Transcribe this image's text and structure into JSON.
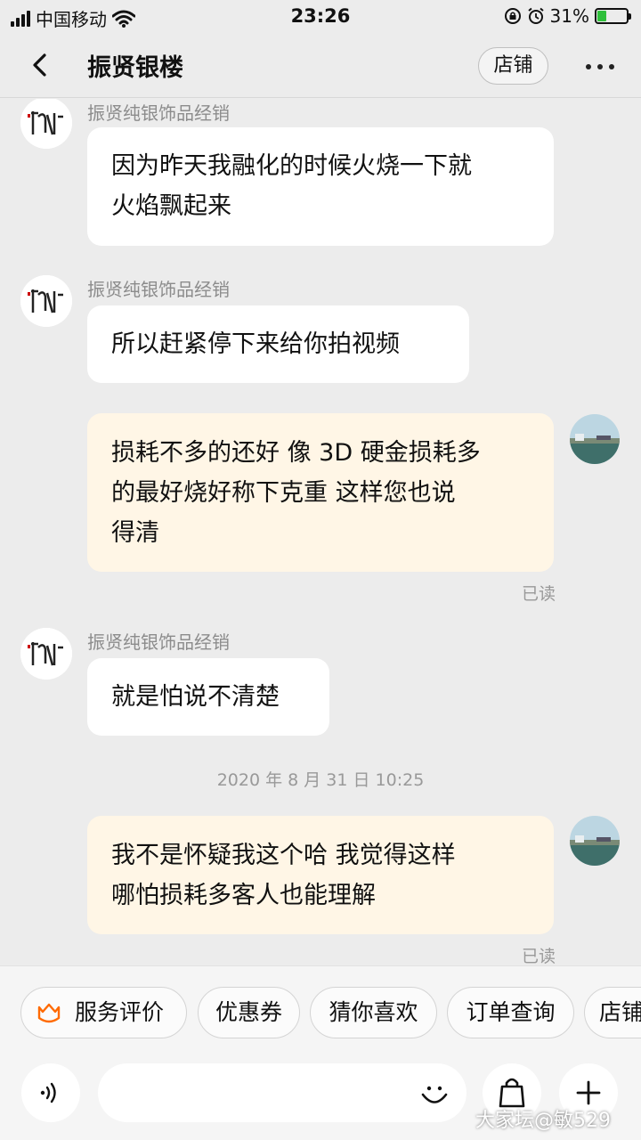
{
  "status_bar": {
    "carrier": "中国移动",
    "time": "23:26",
    "battery_percent": "31%",
    "battery_level": 0.31
  },
  "header": {
    "title": "振贤银楼",
    "shop_button_label": "店铺"
  },
  "messages": [
    {
      "sender": "振贤纯银饰品经销",
      "text_lines": [
        "因为昨天我融化的时候火烧一下就",
        "火焰飘起来"
      ]
    },
    {
      "sender": "振贤纯银饰品经销",
      "text_lines": [
        "所以赶紧停下来给你拍视频"
      ]
    },
    {
      "text_lines": [
        "损耗不多的还好 像 3D 硬金损耗多",
        "的最好烧好称下克重 这样您也说",
        "得清"
      ],
      "status": "已读"
    },
    {
      "sender": "振贤纯银饰品经销",
      "text_lines": [
        "就是怕说不清楚"
      ]
    },
    {
      "timestamp": "2020 年 8 月 31 日 10:25"
    },
    {
      "text_lines": [
        "我不是怀疑我这个哈 我觉得这样",
        "哪怕损耗多客人也能理解"
      ],
      "status": "已读"
    }
  ],
  "quick_actions": [
    "服务评价",
    "优惠券",
    "猜你喜欢",
    "订单查询",
    "店铺"
  ],
  "input": {
    "placeholder": ""
  },
  "watermark": "大家坛@敏529",
  "colors": {
    "background": "#ececec",
    "incoming_bubble": "#ffffff",
    "outgoing_bubble": "#fff6e6",
    "accent": "#ff6a00",
    "battery": "#2fbf3b"
  },
  "icons": [
    "back-icon",
    "more-icon",
    "service-review-icon",
    "voice-icon",
    "emoji-icon",
    "bag-icon",
    "plus-icon",
    "wifi-icon",
    "alarm-icon",
    "lock-rotation-icon"
  ]
}
